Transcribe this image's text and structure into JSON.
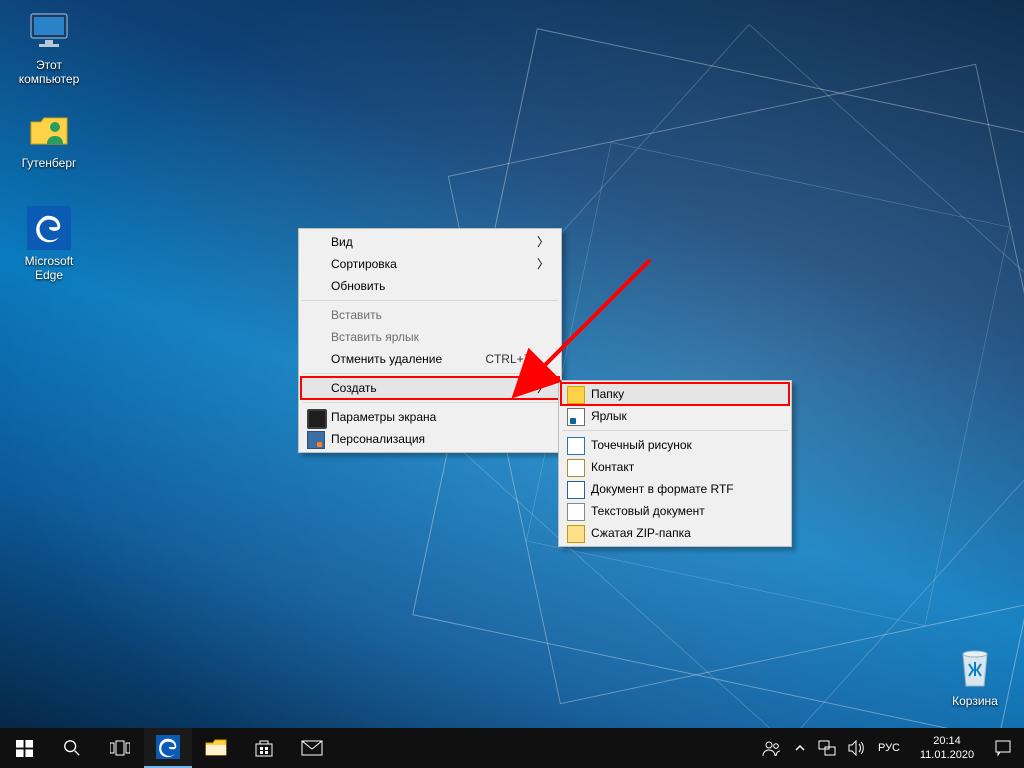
{
  "desktop_icons": {
    "this_pc": "Этот\nкомпьютер",
    "user_folder": "Гутенберг",
    "edge": "Microsoft\nEdge",
    "recycle_bin": "Корзина"
  },
  "context_menu": {
    "view": "Вид",
    "sort": "Сортировка",
    "refresh": "Обновить",
    "paste": "Вставить",
    "paste_shortcut": "Вставить ярлык",
    "undo_delete": "Отменить удаление",
    "undo_delete_shortcut": "CTRL+Z",
    "new": "Создать",
    "display_settings": "Параметры экрана",
    "personalize": "Персонализация"
  },
  "submenu_new": {
    "folder": "Папку",
    "shortcut": "Ярлык",
    "bitmap": "Точечный рисунок",
    "contact": "Контакт",
    "rtf": "Документ в формате RTF",
    "text": "Текстовый документ",
    "zip": "Сжатая ZIP-папка"
  },
  "taskbar": {
    "start": "Пуск",
    "search": "Поиск",
    "taskview": "Представление задач",
    "edge": "Microsoft Edge",
    "explorer": "Проводник",
    "store": "Microsoft Store",
    "mail": "Почта"
  },
  "tray": {
    "people": "Люди",
    "chevron": "Показать скрытые значки",
    "network": "Сеть",
    "volume": "Громкость",
    "lang": "РУС",
    "time": "20:14",
    "date": "11.01.2020",
    "action_center": "Центр уведомлений"
  }
}
